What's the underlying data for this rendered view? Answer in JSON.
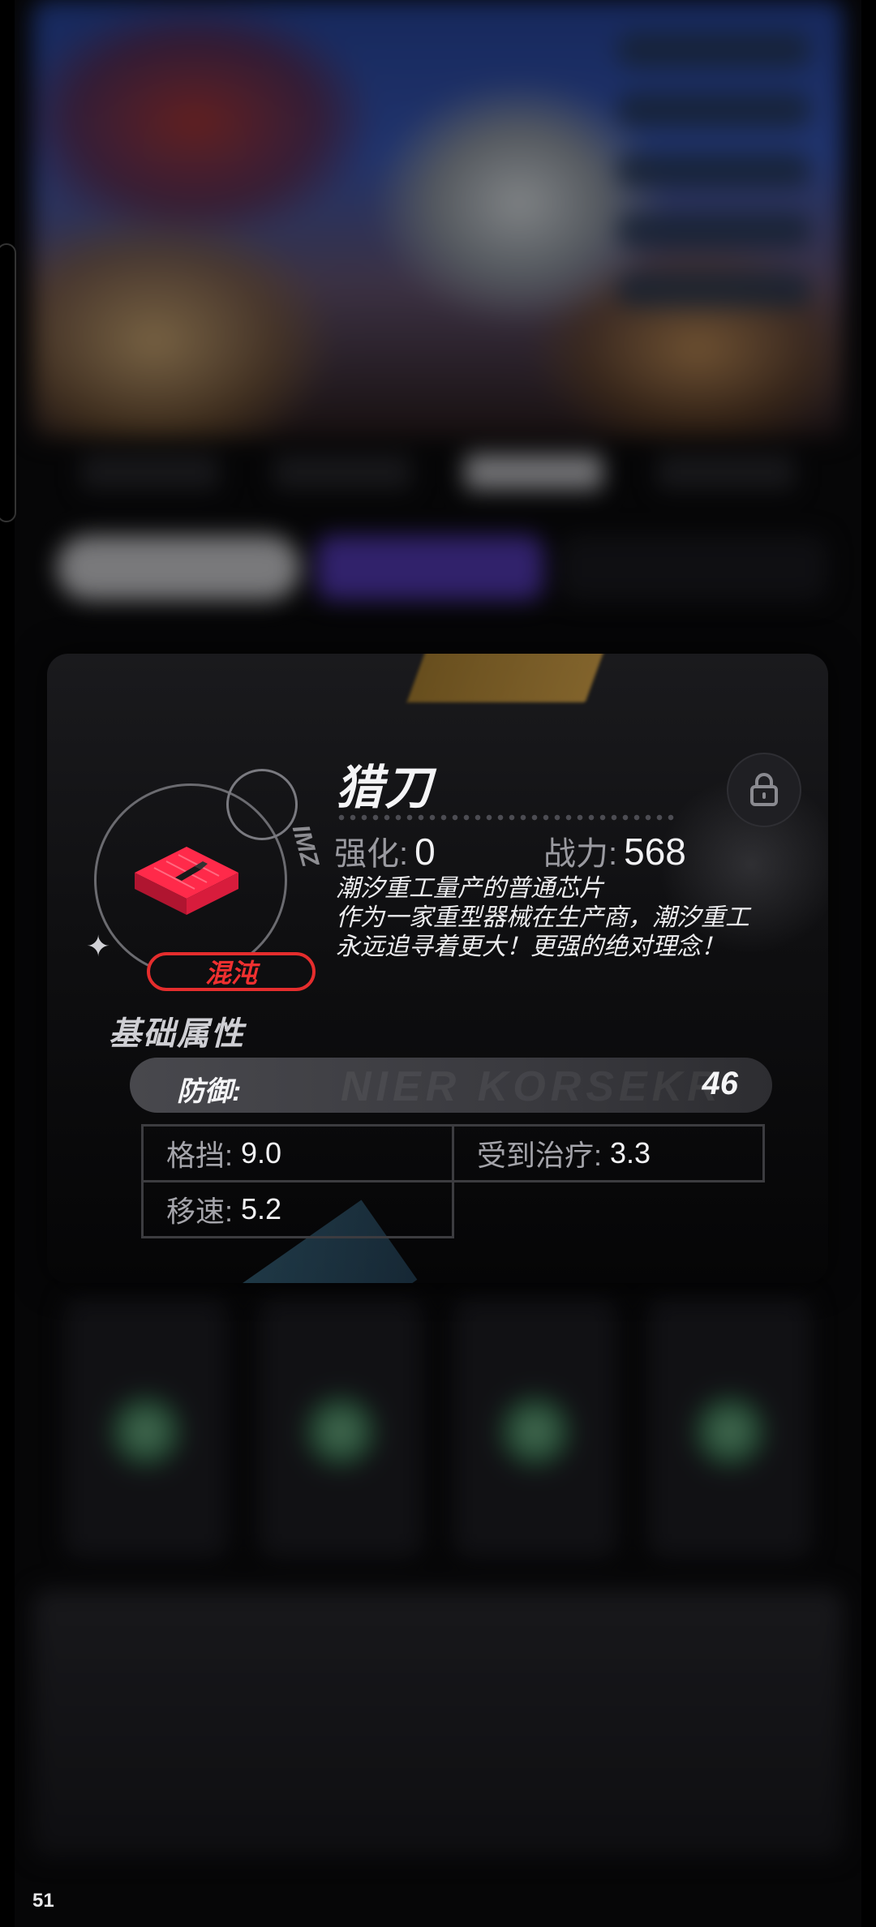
{
  "item": {
    "name": "猎刀",
    "faction": "混沌",
    "enhance_label": "强化:",
    "enhance_value": "0",
    "power_label": "战力:",
    "power_value": "568",
    "description": [
      "潮汐重工量产的普通芯片",
      "作为一家重型器械在生产商，潮汐重工",
      "永远追寻着更大！更强的绝对理念！"
    ],
    "locked": false
  },
  "attributes": {
    "section_title": "基础属性",
    "main": {
      "label": "防御:",
      "value": "46"
    },
    "sub": [
      {
        "label": "格挡:",
        "value": "9.0"
      },
      {
        "label": "受到治疗:",
        "value": "3.3"
      },
      {
        "label": "移速:",
        "value": "5.2"
      }
    ]
  },
  "overlay": {
    "fps": "51"
  },
  "colors": {
    "faction_red": "#e52d2d",
    "card_bg": "#0f0f11",
    "stat_bar": "#48484d"
  },
  "icons": {
    "item": "red-chip-icon",
    "lock": "lock-icon",
    "sparkle": "sparkle-icon"
  }
}
